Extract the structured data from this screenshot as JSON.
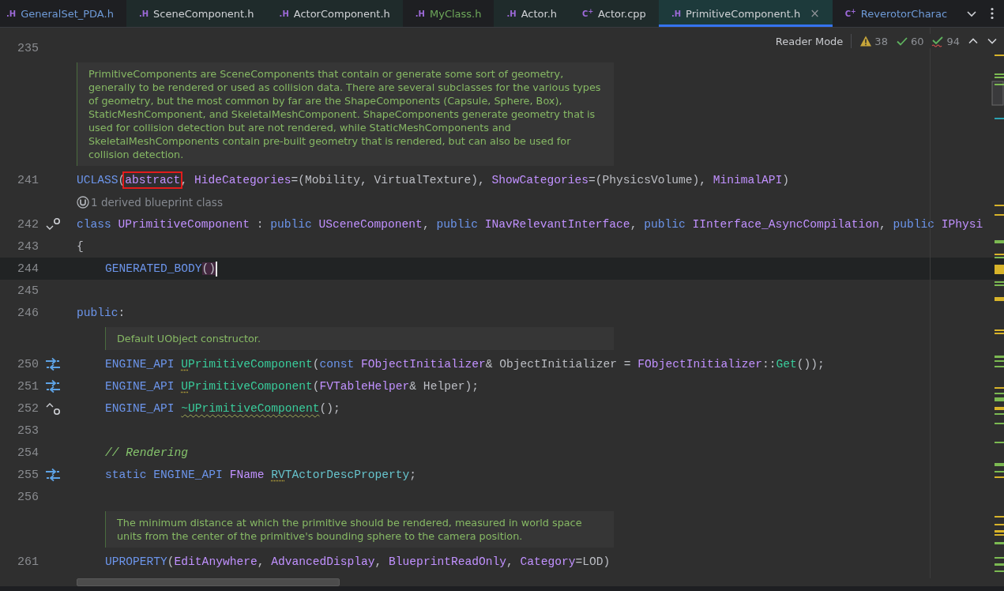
{
  "tabs": [
    {
      "badge": ".H",
      "label": "GeneralSet_PDA.h",
      "color": "#6f9bd8",
      "tinted": false,
      "selected": false
    },
    {
      "badge": ".H",
      "label": "SceneComponent.h",
      "color": "#d0d2d6",
      "tinted": true,
      "selected": false
    },
    {
      "badge": ".H",
      "label": "ActorComponent.h",
      "color": "#d0d2d6",
      "tinted": true,
      "selected": false
    },
    {
      "badge": ".H",
      "label": "MyClass.h",
      "color": "#6ea85a",
      "tinted": false,
      "selected": false
    },
    {
      "badge": ".H",
      "label": "Actor.h",
      "color": "#d0d2d6",
      "tinted": true,
      "selected": false
    },
    {
      "badge": "C$^{+}$",
      "label": "Actor.cpp",
      "color": "#d0d2d6",
      "tinted": true,
      "selected": false
    },
    {
      "badge": ".H",
      "label": "PrimitiveComponent.h",
      "color": "#d0d2d6",
      "tinted": true,
      "selected": true,
      "close": "×"
    },
    {
      "badge": "C$^{+}$",
      "label": "ReverotorCharac",
      "color": "#6f9bd8",
      "tinted": false,
      "selected": false
    }
  ],
  "inspections": {
    "reader_mode": "Reader Mode",
    "warnings": "38",
    "passed": "60",
    "typos": "94"
  },
  "rows": [
    {
      "kind": "code",
      "number": "235",
      "tokens": []
    },
    {
      "kind": "doc",
      "indented": false,
      "text": "PrimitiveComponents are SceneComponents that contain or generate some sort of geometry, generally to be rendered or used as collision data. There are several subclasses for the various types of geometry, but the most common by far are the ShapeComponents (Capsule, Sphere, Box), StaticMeshComponent, and SkeletalMeshComponent. ShapeComponents generate geometry that is used for collision detection but are not rendered, while StaticMeshComponents and SkeletalMeshComponents contain pre-built geometry that is rendered, but can also be used for collision detection."
    },
    {
      "kind": "code",
      "number": "241",
      "tokens": [
        {
          "t": "UCLASS",
          "kind": "macro"
        },
        {
          "t": "(",
          "kind": "plain"
        },
        {
          "t": "abstract",
          "kind": "type",
          "boxed": true
        },
        {
          "t": ",",
          "kind": "plain",
          "gap": true
        },
        {
          "t": "HideCategories",
          "kind": "type"
        },
        {
          "t": "=(Mobility, VirtualTexture),",
          "kind": "plain",
          "gap": true
        },
        {
          "t": "ShowCategories",
          "kind": "type"
        },
        {
          "t": "=(PhysicsVolume),",
          "kind": "plain",
          "gap": true
        },
        {
          "t": "MinimalAPI",
          "kind": "type"
        },
        {
          "t": ")",
          "kind": "plain"
        }
      ]
    },
    {
      "kind": "hint",
      "text": "1 derived blueprint class"
    },
    {
      "kind": "code",
      "number": "242",
      "gutter": {
        "kind": "fold-down"
      },
      "tokens": [
        {
          "t": "class",
          "kind": "kw",
          "gap": true
        },
        {
          "t": "UPrimitiveComponent",
          "kind": "type",
          "gap": true
        },
        {
          "t": ":",
          "kind": "plain",
          "gap": true
        },
        {
          "t": "public",
          "kind": "kw",
          "gap": true
        },
        {
          "t": "USceneComponent",
          "kind": "type"
        },
        {
          "t": ",",
          "kind": "plain",
          "gap": true
        },
        {
          "t": "public",
          "kind": "kw",
          "gap": true
        },
        {
          "t": "INavRelevantInterface",
          "kind": "type"
        },
        {
          "t": ",",
          "kind": "plain",
          "gap": true
        },
        {
          "t": "public",
          "kind": "kw",
          "gap": true
        },
        {
          "t": "IInterface_AsyncCompilation",
          "kind": "type"
        },
        {
          "t": ",",
          "kind": "plain",
          "gap": true
        },
        {
          "t": "public",
          "kind": "kw",
          "gap": true
        },
        {
          "t": "IPhysi",
          "kind": "type"
        }
      ]
    },
    {
      "kind": "code",
      "number": "243",
      "tokens": [
        {
          "t": "{",
          "kind": "plain"
        }
      ]
    },
    {
      "kind": "code",
      "number": "244",
      "current": true,
      "indented": true,
      "tokens": [
        {
          "t": "GENERATED_BODY",
          "kind": "macro"
        },
        {
          "t": "()",
          "kind": "plain",
          "matched": true,
          "caret": true
        }
      ]
    },
    {
      "kind": "code",
      "number": "245",
      "tokens": []
    },
    {
      "kind": "code",
      "number": "246",
      "tokens": [
        {
          "t": "public",
          "kind": "kw"
        },
        {
          "t": ":",
          "kind": "plain"
        }
      ]
    },
    {
      "kind": "doc",
      "indented": true,
      "text": "Default UObject constructor."
    },
    {
      "kind": "code",
      "number": "250",
      "gutter": {
        "kind": "swap"
      },
      "indented": true,
      "tokens": [
        {
          "t": "ENGINE_API",
          "kind": "macro",
          "gap": true
        },
        {
          "t": "U",
          "kind": "func",
          "dotted": true
        },
        {
          "t": "PrimitiveComponent",
          "kind": "func"
        },
        {
          "t": "(",
          "kind": "plain"
        },
        {
          "t": "const",
          "kind": "kw",
          "gap": true
        },
        {
          "t": "FObjectInitializer",
          "kind": "type"
        },
        {
          "t": "& ObjectInitializer =",
          "kind": "plain",
          "gap": true
        },
        {
          "t": "FObjectInitializer",
          "kind": "type"
        },
        {
          "t": "::",
          "kind": "plain"
        },
        {
          "t": "Get",
          "kind": "func"
        },
        {
          "t": "());",
          "kind": "plain"
        }
      ]
    },
    {
      "kind": "code",
      "number": "251",
      "gutter": {
        "kind": "swap"
      },
      "indented": true,
      "tokens": [
        {
          "t": "ENGINE_API",
          "kind": "macro",
          "gap": true
        },
        {
          "t": "U",
          "kind": "func",
          "dotted": true
        },
        {
          "t": "PrimitiveComponent",
          "kind": "func"
        },
        {
          "t": "(",
          "kind": "plain"
        },
        {
          "t": "FVTableHelper",
          "kind": "type"
        },
        {
          "t": "& Helper);",
          "kind": "plain"
        }
      ]
    },
    {
      "kind": "code",
      "number": "252",
      "gutter": {
        "kind": "fold-up"
      },
      "indented": true,
      "tokens": [
        {
          "t": "ENGINE_API",
          "kind": "macro",
          "gap": true
        },
        {
          "t": "~UPrimitiveComponent",
          "kind": "func",
          "wavy": true
        },
        {
          "t": "();",
          "kind": "plain"
        }
      ]
    },
    {
      "kind": "code",
      "number": "253",
      "tokens": []
    },
    {
      "kind": "code",
      "number": "254",
      "indented": true,
      "tokens": [
        {
          "t": "// Rendering",
          "kind": "comment"
        }
      ]
    },
    {
      "kind": "code",
      "number": "255",
      "gutter": {
        "kind": "swap"
      },
      "indented": true,
      "tokens": [
        {
          "t": "static",
          "kind": "kw",
          "gap": true
        },
        {
          "t": "ENGINE_API",
          "kind": "macro",
          "gap": true
        },
        {
          "t": "FName",
          "kind": "type",
          "gap": true
        },
        {
          "t": "RV",
          "kind": "field",
          "dotted": true
        },
        {
          "t": "TActorDescProperty",
          "kind": "field"
        },
        {
          "t": ";",
          "kind": "plain"
        }
      ]
    },
    {
      "kind": "code",
      "number": "256",
      "tokens": []
    },
    {
      "kind": "doc",
      "indented": true,
      "text": "The minimum distance at which the primitive should be rendered, measured in world space units from the center of the primitive's bounding sphere to the camera position."
    },
    {
      "kind": "code",
      "number": "261",
      "indented": true,
      "tokens": [
        {
          "t": "UPROPERTY",
          "kind": "macro"
        },
        {
          "t": "(",
          "kind": "plain"
        },
        {
          "t": "EditAnywhere",
          "kind": "type"
        },
        {
          "t": ",",
          "kind": "plain",
          "gap": true
        },
        {
          "t": "AdvancedDisplay",
          "kind": "type"
        },
        {
          "t": ",",
          "kind": "plain",
          "gap": true
        },
        {
          "t": "BlueprintReadOnly",
          "kind": "type"
        },
        {
          "t": ",",
          "kind": "plain",
          "gap": true
        },
        {
          "t": "Category",
          "kind": "type"
        },
        {
          "t": "=LOD)",
          "kind": "plain"
        }
      ]
    }
  ]
}
